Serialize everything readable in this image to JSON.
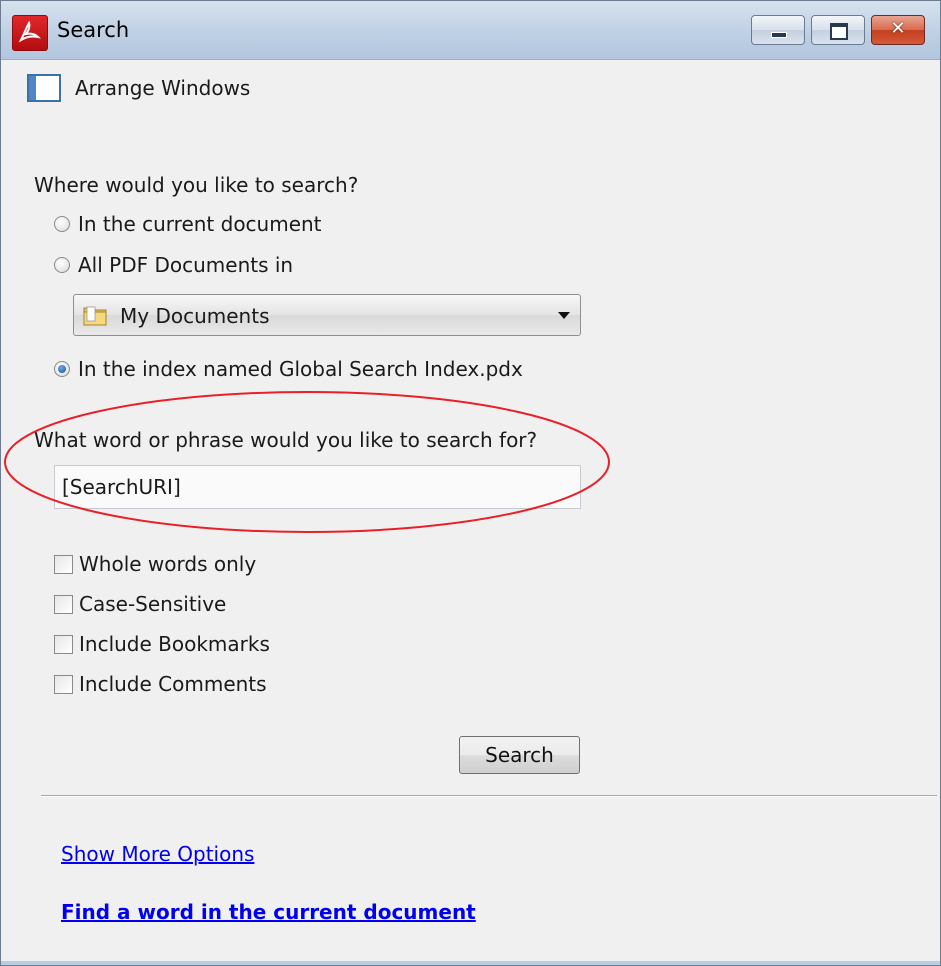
{
  "window": {
    "title": "Search",
    "controls": {
      "minimize": "",
      "maximize": "",
      "close": "✕"
    }
  },
  "toolbar": {
    "arrange_label": "Arrange Windows"
  },
  "where": {
    "question": "Where would you like to search?",
    "options": [
      {
        "label": "In the current document",
        "checked": false
      },
      {
        "label": "All PDF Documents in",
        "checked": false
      },
      {
        "label": "In the index named Global Search Index.pdx",
        "checked": true
      }
    ],
    "folder_dropdown": {
      "value": "My Documents"
    }
  },
  "phrase": {
    "question": "What word or phrase would you like to search for?",
    "input_value": "[SearchURI]"
  },
  "options": [
    {
      "label": "Whole words only",
      "checked": false
    },
    {
      "label": "Case-Sensitive",
      "checked": false
    },
    {
      "label": "Include Bookmarks",
      "checked": false
    },
    {
      "label": "Include Comments",
      "checked": false
    }
  ],
  "search_button": "Search",
  "links": {
    "more_options": "Show More Options",
    "find_word": "Find a word in the current document"
  },
  "colors": {
    "annotation_ellipse": "#e8202a",
    "link": "#0000ee",
    "title_bar": "#bfd0e4"
  }
}
